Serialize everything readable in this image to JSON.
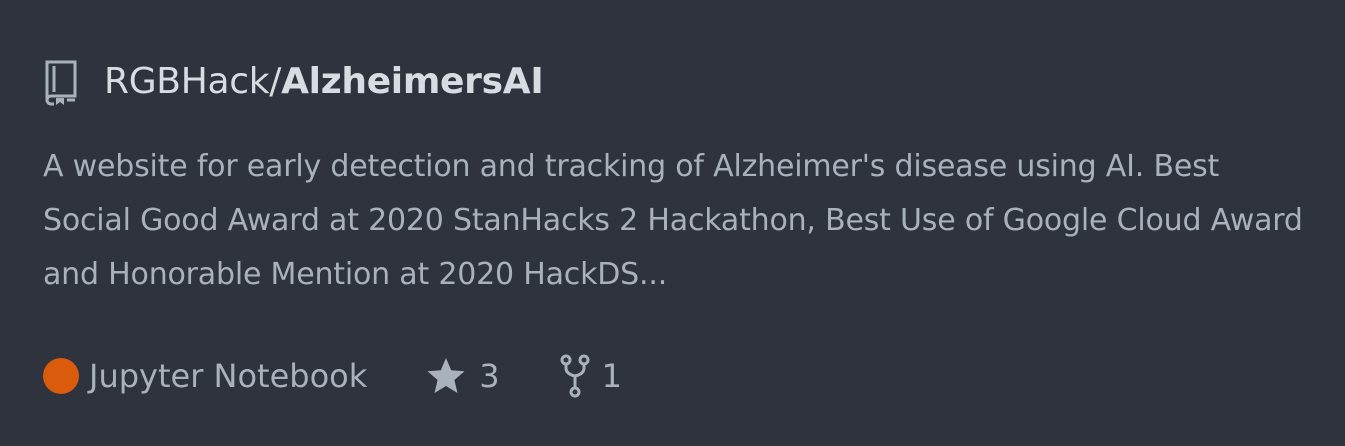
{
  "repo": {
    "owner": "RGBHack/",
    "name": "AlzheimersAI",
    "icon": "repo-book-icon",
    "description": "A website for early detection and tracking of Alzheimer's disease using AI. Best Social Good Award at 2020 StanHacks 2 Hackathon, Best Use of Google Cloud Award and Honorable Mention at 2020 HackDS..."
  },
  "stats": {
    "language": "Jupyter Notebook",
    "language_color": "#da5b0b",
    "stars": "3",
    "forks": "1"
  },
  "colors": {
    "background": "#2f333d",
    "title": "#d7dce2",
    "text": "#a9b1bc"
  }
}
